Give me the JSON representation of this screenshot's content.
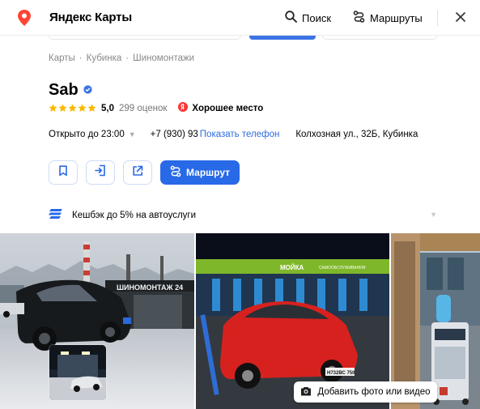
{
  "header": {
    "app_title": "Яндекс Карты",
    "search_label": "Поиск",
    "routes_label": "Маршруты"
  },
  "breadcrumb": [
    "Карты",
    "Кубинка",
    "Шиномонтажи"
  ],
  "business": {
    "name": "Sab",
    "rating": "5,0",
    "reviews": "299 оценок",
    "badge": "Хорошее место",
    "hours": "Открыто до 23:00",
    "phone_visible": "+7 (930) 93",
    "phone_tail": "",
    "show_phone": "Показать телефон",
    "address": "Колхозная ул., 32Б, Кубинка"
  },
  "actions": {
    "route_label": "Маршрут",
    "icons": [
      "bookmark-icon",
      "entrance-icon",
      "share-icon",
      "route-icon"
    ]
  },
  "cashback": {
    "label": "Кешбэк до 5% на автоуслуги"
  },
  "gallery": {
    "sign_left": "ШИНОМОНТАЖ 24",
    "sign_middle_1": "МОЙКА",
    "sign_middle_2": "САМООБСЛУЖИВАНИЯ",
    "plate": "Н732ВС 750",
    "add_photo_label": "Добавить фото или видео"
  },
  "colors": {
    "accent": "#2869e8",
    "link": "#2d6cdf",
    "star": "#fcb800",
    "logo_pin": "#f43",
    "badge_ya": "#f33"
  }
}
